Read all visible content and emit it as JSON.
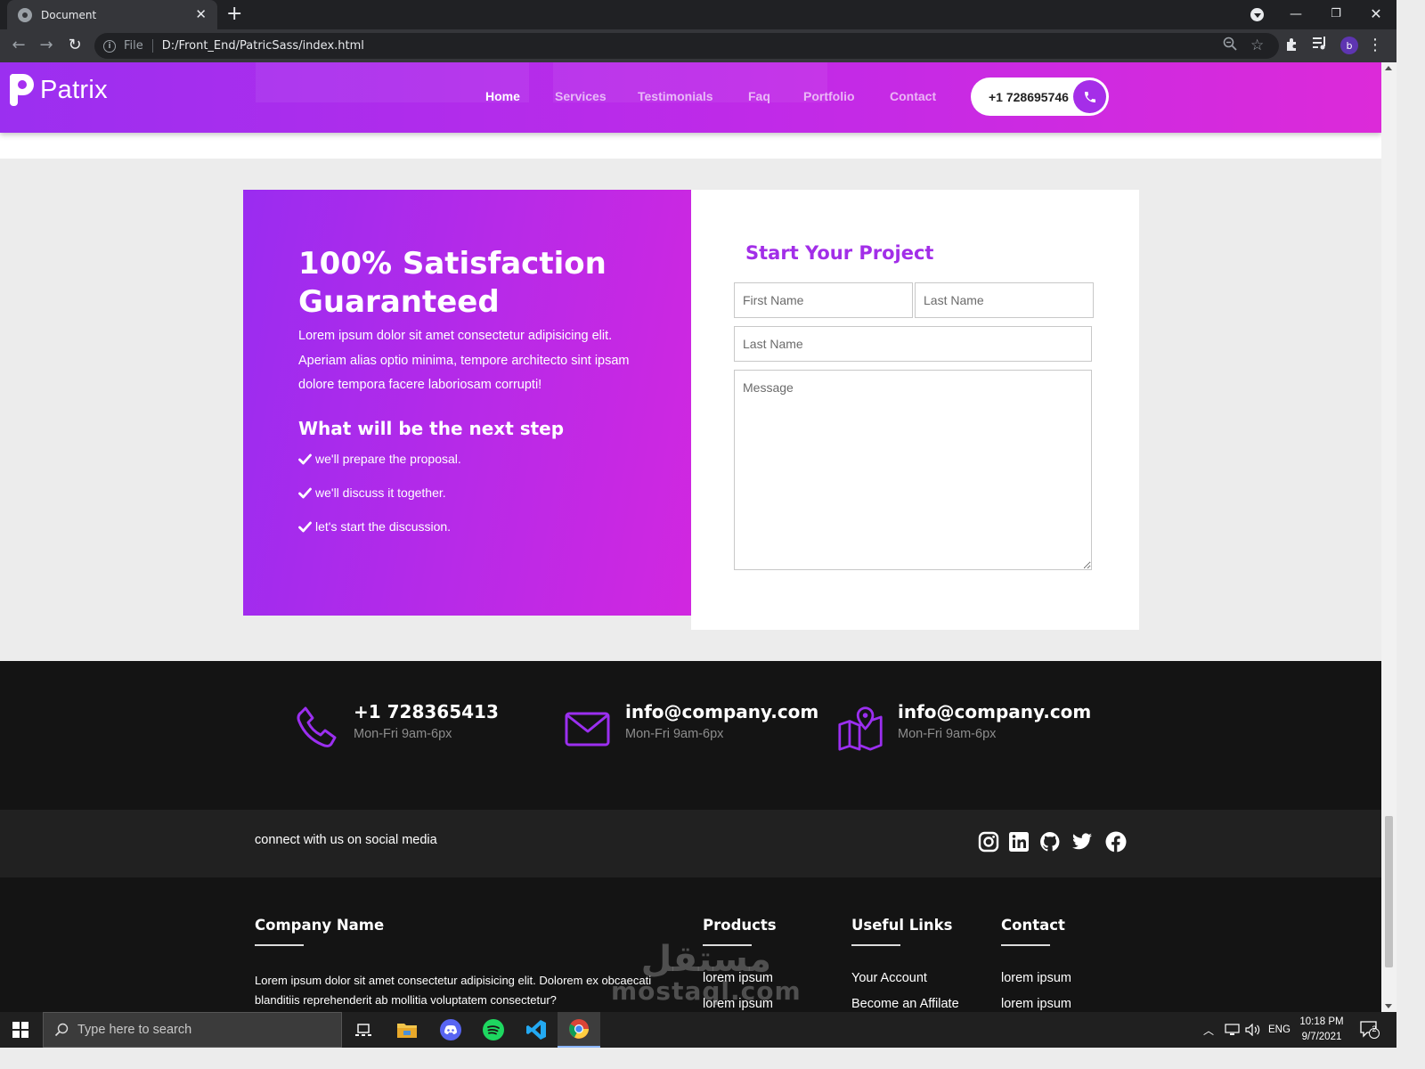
{
  "browser": {
    "tab_title": "Document",
    "url_scheme": "File",
    "url": "D:/Front_End/PatricSass/index.html",
    "profile_initial": "b"
  },
  "site": {
    "brand": "Patrix",
    "nav": [
      "Home",
      "Services",
      "Testimonials",
      "Faq",
      "Portfolio",
      "Contact"
    ],
    "active_nav": "Home",
    "phone_button": "+1 728695746",
    "colors": {
      "accent": "#a22ee8",
      "gradient_start": "#9a2cf0",
      "gradient_end": "#d127e0",
      "dark": "#141414"
    }
  },
  "satisfaction": {
    "title": "100% Satisfaction Guaranteed",
    "lead": "Lorem ipsum dolor sit amet consectetur adipisicing elit. Aperiam alias optio minima, tempore architecto sint ipsam dolore tempora facere laboriosam corrupti!",
    "next_title": "What will be the next step",
    "steps": [
      "we'll prepare the proposal.",
      "we'll discuss it together.",
      "let's start the discussion."
    ]
  },
  "project_form": {
    "title": "Start Your Project",
    "first_name_placeholder": "First Name",
    "last_name_placeholder": "Last Name",
    "email_placeholder": "Last Name",
    "message_placeholder": "Message"
  },
  "contact_info": [
    {
      "icon": "phone-icon",
      "main": "+1 728365413",
      "sub": "Mon-Fri 9am-6px"
    },
    {
      "icon": "envelope-icon",
      "main": "info@company.com",
      "sub": "Mon-Fri 9am-6px"
    },
    {
      "icon": "map-pin-icon",
      "main": "info@company.com",
      "sub": "Mon-Fri 9am-6px"
    }
  ],
  "social": {
    "text": "connect with us on social media",
    "icons": [
      "instagram-icon",
      "linkedin-icon",
      "github-icon",
      "twitter-icon",
      "facebook-icon"
    ]
  },
  "footer": {
    "company": {
      "title": "Company Name",
      "text": "Lorem ipsum dolor sit amet consectetur adipisicing elit. Dolorem ex obcaecati blanditiis reprehenderit ab mollitia voluptatem consectetur?"
    },
    "products": {
      "title": "Products",
      "links": [
        "lorem ipsum",
        "lorem ipsum"
      ]
    },
    "useful": {
      "title": "Useful Links",
      "links": [
        "Your Account",
        "Become an Affilate"
      ]
    },
    "contact": {
      "title": "Contact",
      "links": [
        "lorem ipsum",
        "lorem ipsum"
      ]
    }
  },
  "watermark": {
    "arabic": "مستقل",
    "latin": "mostaql.com"
  },
  "taskbar": {
    "search_placeholder": "Type here to search",
    "language": "ENG",
    "time": "10:18 PM",
    "date": "9/7/2021",
    "notifications": "2"
  }
}
